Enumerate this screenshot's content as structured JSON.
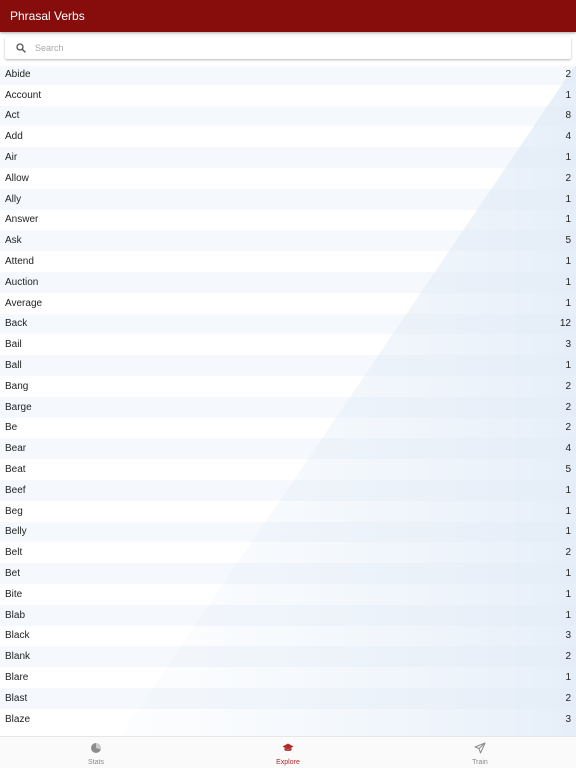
{
  "app": {
    "title": "Phrasal Verbs"
  },
  "search": {
    "placeholder": "Search",
    "value": ""
  },
  "items": [
    {
      "word": "Abide",
      "count": "2"
    },
    {
      "word": "Account",
      "count": "1"
    },
    {
      "word": "Act",
      "count": "8"
    },
    {
      "word": "Add",
      "count": "4"
    },
    {
      "word": "Air",
      "count": "1"
    },
    {
      "word": "Allow",
      "count": "2"
    },
    {
      "word": "Ally",
      "count": "1"
    },
    {
      "word": "Answer",
      "count": "1"
    },
    {
      "word": "Ask",
      "count": "5"
    },
    {
      "word": "Attend",
      "count": "1"
    },
    {
      "word": "Auction",
      "count": "1"
    },
    {
      "word": "Average",
      "count": "1"
    },
    {
      "word": "Back",
      "count": "12"
    },
    {
      "word": "Bail",
      "count": "3"
    },
    {
      "word": "Ball",
      "count": "1"
    },
    {
      "word": "Bang",
      "count": "2"
    },
    {
      "word": "Barge",
      "count": "2"
    },
    {
      "word": "Be",
      "count": "2"
    },
    {
      "word": "Bear",
      "count": "4"
    },
    {
      "word": "Beat",
      "count": "5"
    },
    {
      "word": "Beef",
      "count": "1"
    },
    {
      "word": "Beg",
      "count": "1"
    },
    {
      "word": "Belly",
      "count": "1"
    },
    {
      "word": "Belt",
      "count": "2"
    },
    {
      "word": "Bet",
      "count": "1"
    },
    {
      "word": "Bite",
      "count": "1"
    },
    {
      "word": "Blab",
      "count": "1"
    },
    {
      "word": "Black",
      "count": "3"
    },
    {
      "word": "Blank",
      "count": "2"
    },
    {
      "word": "Blare",
      "count": "1"
    },
    {
      "word": "Blast",
      "count": "2"
    },
    {
      "word": "Blaze",
      "count": "3"
    }
  ],
  "tabs": [
    {
      "label": "Stats",
      "icon": "pie-chart-icon",
      "active": false
    },
    {
      "label": "Explore",
      "icon": "graduation-cap-icon",
      "active": true
    },
    {
      "label": "Train",
      "icon": "paper-plane-icon",
      "active": false
    }
  ],
  "colors": {
    "header": "#870d0d",
    "active_tab": "#b22a2a",
    "inactive_tab": "#8a8a8a"
  }
}
